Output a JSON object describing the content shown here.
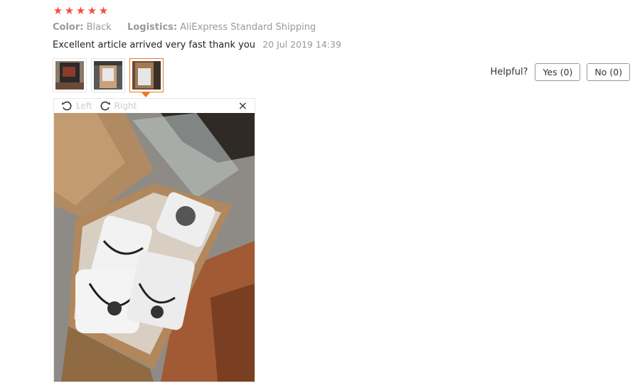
{
  "rating": {
    "stars": 5,
    "icon": "star-icon",
    "color": "#f44d43"
  },
  "meta": {
    "color_label": "Color:",
    "color_value": "Black",
    "logistics_label": "Logistics:",
    "logistics_value": "AliExpress Standard Shipping"
  },
  "review": {
    "text": "Excellent article arrived very fast thank you",
    "date": "20 Jul 2019 14:39"
  },
  "thumbnails": [
    {
      "name": "photo-1",
      "active": false
    },
    {
      "name": "photo-2",
      "active": false
    },
    {
      "name": "photo-3",
      "active": true
    }
  ],
  "helpful": {
    "label": "Helpful?",
    "yes_label": "Yes (0)",
    "no_label": "No (0)"
  },
  "viewer": {
    "rotate_left_label": "Left",
    "rotate_right_label": "Right",
    "close_symbol": "×"
  },
  "colors": {
    "accent": "#f0781e",
    "muted": "#999999"
  }
}
